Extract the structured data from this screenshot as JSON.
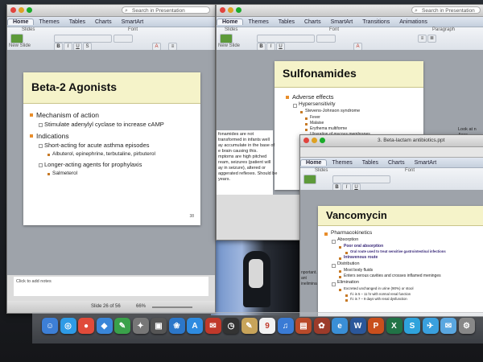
{
  "search_placeholder": "Search in Presentation",
  "tabs_a": [
    "Home",
    "Themes",
    "Tables",
    "Charts",
    "SmartArt"
  ],
  "tabs_b": [
    "Home",
    "Themes",
    "Tables",
    "Charts",
    "SmartArt",
    "Transitions",
    "Animations"
  ],
  "tabs_c": [
    "Home",
    "Themes",
    "Tables",
    "Charts",
    "SmartArt"
  ],
  "ribbon": {
    "slides": "Slides",
    "font": "Font",
    "paragraph": "Paragraph",
    "new_slide": "New Slide"
  },
  "win1": {
    "title": "Beta-2 Agonists",
    "bullets": [
      {
        "level": 1,
        "text": "Mechanism of action"
      },
      {
        "level": 2,
        "text": "Stimulate adenylyl cyclase to increase cAMP"
      },
      {
        "level": 1,
        "text": "Indications"
      },
      {
        "level": 2,
        "text": "Short-acting for acute asthma episodes"
      },
      {
        "level": 3,
        "text": "Albuterol, epinephrine, terbutaline, pirbuterol"
      },
      {
        "level": 2,
        "text": "Longer-acting agents for prophylaxis"
      },
      {
        "level": 3,
        "text": "Salmeterol"
      }
    ],
    "slide_num": "38",
    "notes": "Click to add notes",
    "status": "Slide 26 of 56",
    "zoom": "66%"
  },
  "win2": {
    "title": "Sulfonamides",
    "bullets": [
      {
        "level": 1,
        "text": "Adverse effects"
      },
      {
        "level": 2,
        "text": "Hypersensitivity"
      },
      {
        "level": 3,
        "text": "Stevens-Johnson syndrome"
      },
      {
        "level": 3,
        "text": "Fever"
      },
      {
        "level": 3,
        "text": "Malaise"
      },
      {
        "level": 3,
        "text": "Erythema multiforme"
      },
      {
        "level": 3,
        "text": "Ulceration of mucous membranes"
      }
    ],
    "left_text": [
      "fonamides are not",
      "transformed in infants well",
      "ay accumulate in the base of",
      "e brain causing this.",
      "mptoms are high pitched",
      "ream, seizures (patient will",
      "ay in seizure), altered or",
      "aggerated reflexes. Should be",
      "years."
    ],
    "right_text": [
      "Look at n",
      "Assc."
    ]
  },
  "win3": {
    "doc_title": "3. Beta-lactam antibiotics.ppt",
    "title": "Vancomycin",
    "bullets": [
      {
        "level": 1,
        "text": "Pharmacokinetics"
      },
      {
        "level": 2,
        "text": "Absorption"
      },
      {
        "level": 3,
        "text": "Poor oral absorption"
      },
      {
        "level": 4,
        "text": "Oral route used to treat sensitive gastrointestinal infections"
      },
      {
        "level": 3,
        "text": "Intravenous route"
      },
      {
        "level": 2,
        "text": "Distribution"
      },
      {
        "level": 3,
        "text": "Most body fluids"
      },
      {
        "level": 3,
        "text": "Enters serous cavities and crosses inflamed meninges"
      },
      {
        "level": 2,
        "text": "Elimination"
      },
      {
        "level": 3,
        "text": "Excreted unchanged in urine (90%) or stool"
      },
      {
        "level": 4,
        "text": "t½ is 5 – 11 hr with normal renal function"
      },
      {
        "level": 4,
        "text": "t½ is 7 – 9 days with renal dysfunction"
      }
    ],
    "left_text": [
      "nportant.",
      "ant",
      "inelimina"
    ]
  },
  "dock": {
    "icons": [
      {
        "name": "finder-icon",
        "color": "#3d7fd6",
        "glyph": "☺"
      },
      {
        "name": "safari-icon",
        "color": "#2e9be6",
        "glyph": "◎"
      },
      {
        "name": "chrome-icon",
        "color": "#e04b3a",
        "glyph": "●"
      },
      {
        "name": "dropbox-icon",
        "color": "#3a86d8",
        "glyph": "◆"
      },
      {
        "name": "evernote-icon",
        "color": "#3aa14a",
        "glyph": "✎"
      },
      {
        "name": "launchpad-icon",
        "color": "#777",
        "glyph": "✦"
      },
      {
        "name": "photobooth-icon",
        "color": "#555",
        "glyph": "▣"
      },
      {
        "name": "iphoto-icon",
        "color": "#2c77c9",
        "glyph": "❀"
      },
      {
        "name": "appstore-icon",
        "color": "#2e8be0",
        "glyph": "A"
      },
      {
        "name": "mail-icon",
        "color": "#c0392b",
        "glyph": "✉"
      },
      {
        "name": "stocks-icon",
        "color": "#333",
        "glyph": "◷"
      },
      {
        "name": "notes-icon",
        "color": "#c8a45a",
        "glyph": "✎"
      },
      {
        "name": "calendar-icon",
        "color": "#f2f2f2",
        "glyph": "9"
      },
      {
        "name": "itunes-icon",
        "color": "#3a7bd5",
        "glyph": "♫"
      },
      {
        "name": "photos-icon",
        "color": "#b84a2a",
        "glyph": "▤"
      },
      {
        "name": "iphoto2-icon",
        "color": "#9c3b2a",
        "glyph": "✿"
      },
      {
        "name": "internet-explorer-icon",
        "color": "#3a8fd6",
        "glyph": "e"
      },
      {
        "name": "word-icon",
        "color": "#2b579a",
        "glyph": "W"
      },
      {
        "name": "powerpoint-icon",
        "color": "#c94f1d",
        "glyph": "P"
      },
      {
        "name": "excel-icon",
        "color": "#217346",
        "glyph": "X"
      },
      {
        "name": "skype-icon",
        "color": "#2fa3dc",
        "glyph": "S"
      },
      {
        "name": "twitter-icon",
        "color": "#3aa0de",
        "glyph": "✈"
      },
      {
        "name": "messages-icon",
        "color": "#5aa7e0",
        "glyph": "✉"
      },
      {
        "name": "system-preferences-icon",
        "color": "#888",
        "glyph": "⚙"
      }
    ]
  }
}
